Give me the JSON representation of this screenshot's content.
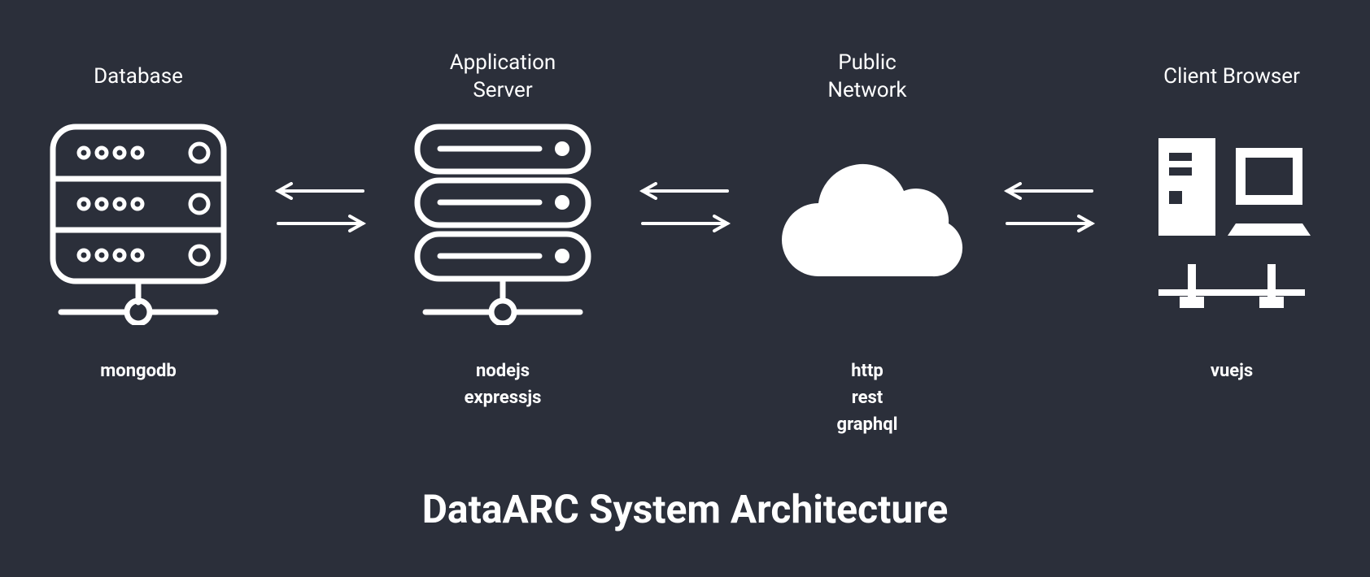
{
  "title": "DataARC System Architecture",
  "nodes": [
    {
      "heading": "Database",
      "tech": "mongodb",
      "icon": "database"
    },
    {
      "heading": "Application\nServer",
      "tech": "nodejs\nexpressjs",
      "icon": "app-server"
    },
    {
      "heading": "Public\nNetwork",
      "tech": "http\nrest\ngraphql",
      "icon": "cloud"
    },
    {
      "heading": "Client Browser",
      "tech": "vuejs",
      "icon": "client"
    }
  ],
  "connections": [
    {
      "between": [
        "Database",
        "Application Server"
      ],
      "bidirectional": true
    },
    {
      "between": [
        "Application Server",
        "Public Network"
      ],
      "bidirectional": true
    },
    {
      "between": [
        "Public Network",
        "Client Browser"
      ],
      "bidirectional": true
    }
  ]
}
